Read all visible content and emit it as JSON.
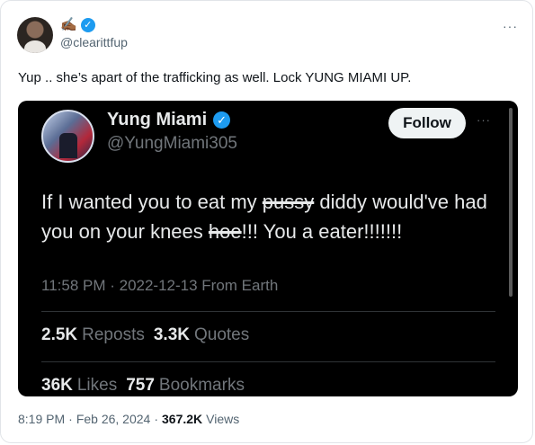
{
  "post": {
    "author_emoji": "✍🏾",
    "handle": "@clearittfup",
    "more_label": "···",
    "text": "Yup .. she’s apart of the trafficking as well. Lock YUNG MIAMI UP.",
    "time": "8:19 PM",
    "date": "Feb 26, 2024",
    "views_count": "367.2K",
    "views_label": "Views",
    "sep": "·"
  },
  "embed": {
    "name": "Yung Miami",
    "handle": "@YungMiami305",
    "follow_label": "Follow",
    "more_label": "···",
    "text_parts": {
      "p1": "If I wanted you to eat my ",
      "s1": "pussy",
      "p2": " diddy would've had you on your knees ",
      "s2": "hoe",
      "p3": "!!! You a eater!!!!!!!"
    },
    "timestamp": "11:58 PM · 2022-12-13 From Earth",
    "stats": {
      "reposts_count": "2.5K",
      "reposts_label": "Reposts",
      "quotes_count": "3.3K",
      "quotes_label": "Quotes",
      "likes_count": "36K",
      "likes_label": "Likes",
      "bookmarks_count": "757",
      "bookmarks_label": "Bookmarks"
    }
  },
  "colors": {
    "accent": "#1d9bf0",
    "embed_bg": "#000000",
    "muted": "#536471"
  },
  "icons": {
    "verified": "verified-badge-icon"
  }
}
